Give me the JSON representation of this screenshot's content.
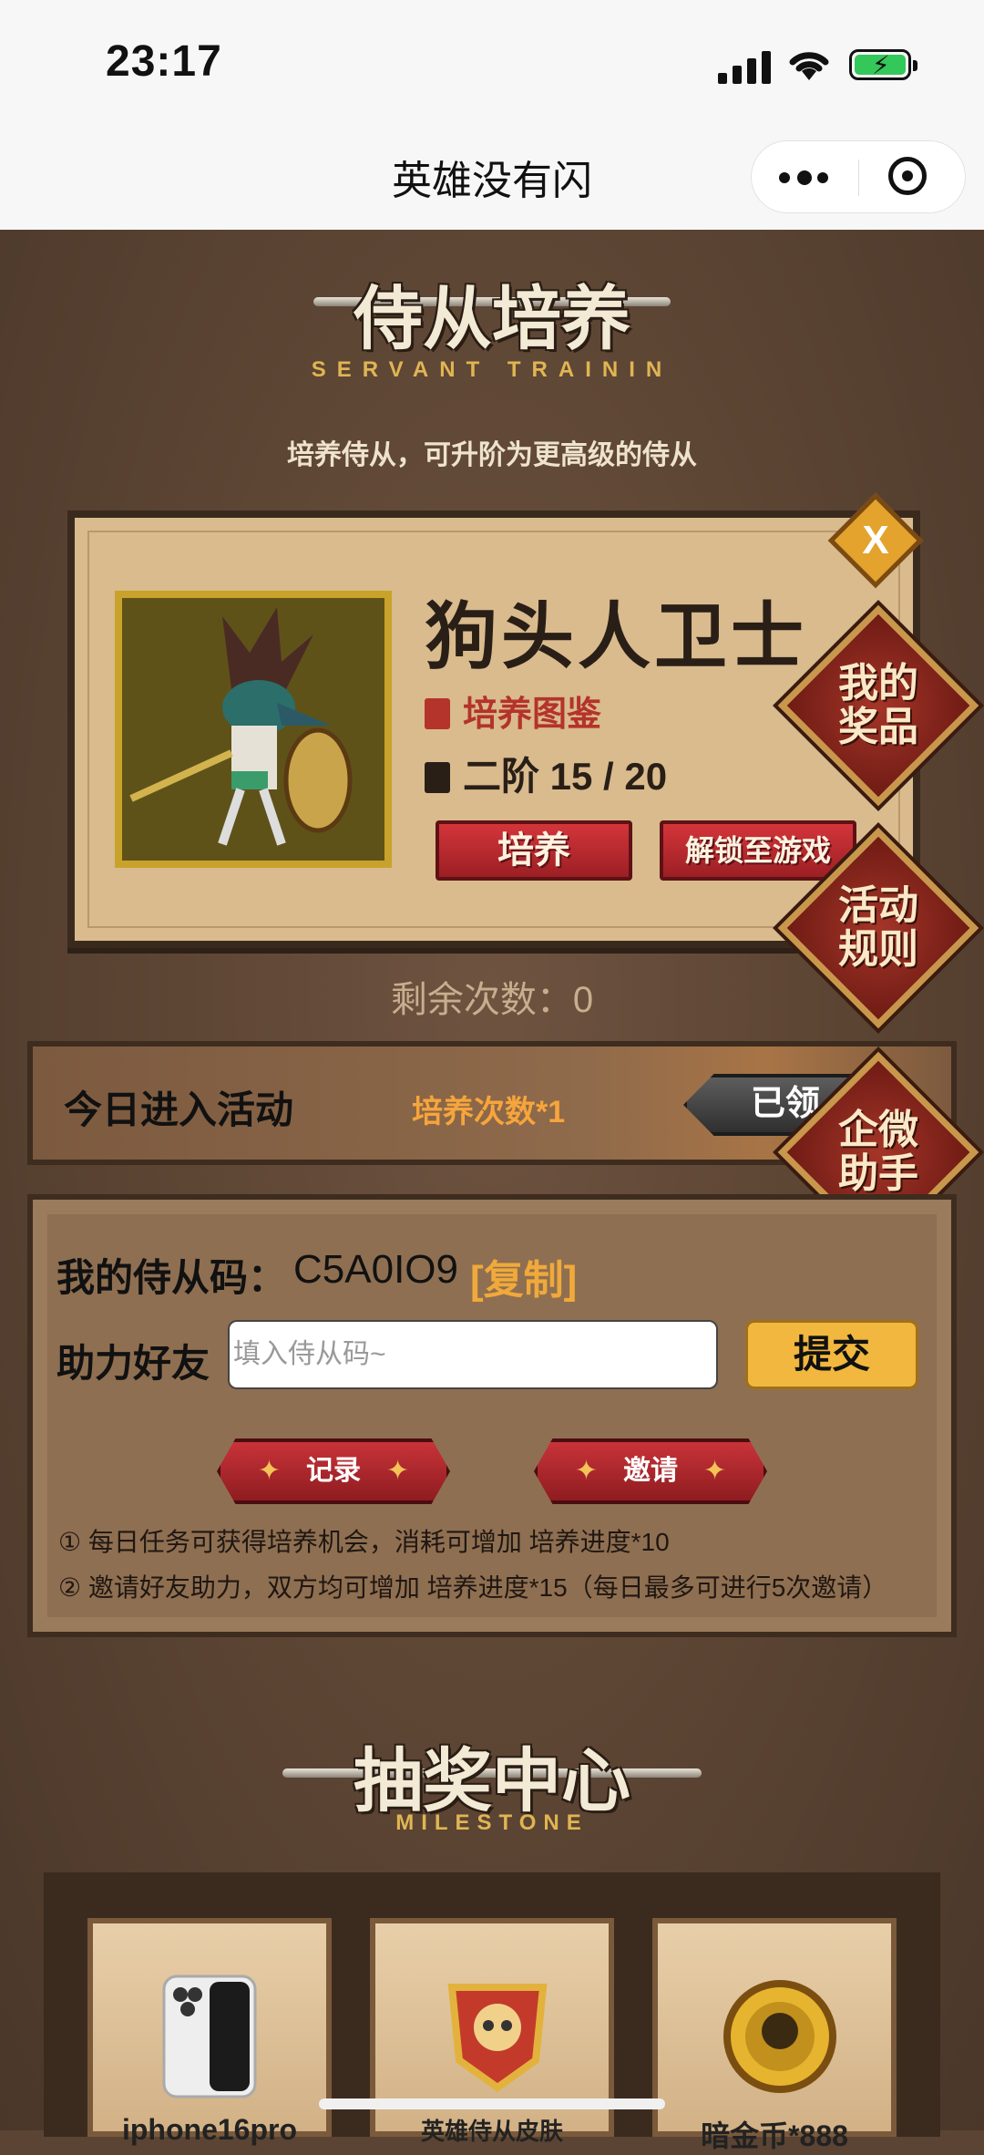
{
  "status_bar": {
    "time": "23:17"
  },
  "nav": {
    "title": "英雄没有闪"
  },
  "banner": {
    "title": "侍从培养",
    "subtitle": "SERVANT TRAININ",
    "tagline": "培养侍从，可升阶为更高级的侍从"
  },
  "servant": {
    "name": "狗头人卫士",
    "atlas_label": "培养图鉴",
    "level_label": "二阶 15 / 20",
    "train_button": "培养",
    "unlock_button": "解锁至游戏",
    "close_icon": "X"
  },
  "side_buttons": [
    {
      "label_line1": "我的",
      "label_line2": "奖品"
    },
    {
      "label_line1": "活动",
      "label_line2": "规则"
    },
    {
      "label_line1": "企微",
      "label_line2": "助手"
    }
  ],
  "remaining": "剩余次数：0",
  "today": {
    "label": "今日进入活动",
    "reward": "培养次数*1",
    "button": "已领"
  },
  "code_panel": {
    "my_code_label": "我的侍从码：",
    "my_code_value": "C5A0IO9",
    "copy_link": "[复制]",
    "help_label": "助力好友",
    "input_placeholder": "填入侍从码~",
    "input_value": "",
    "submit_button": "提交",
    "record_button": "记录",
    "invite_button": "邀请",
    "star_glyph": "✦",
    "rules": [
      "① 每日任务可获得培养机会，消耗可增加 培养进度*10",
      "② 邀请好友助力，双方均可增加 培养进度*15（每日最多可进行5次邀请）"
    ]
  },
  "lottery": {
    "title": "抽奖中心",
    "subtitle": "MILESTONE",
    "prizes": [
      {
        "label": "iphone16pro",
        "icon": "phone-icon"
      },
      {
        "label": "英雄侍从皮肤",
        "icon": "skull-shield-icon"
      },
      {
        "label": "暗金币*888",
        "icon": "skull-coin-icon"
      }
    ]
  },
  "colors": {
    "accent_red": "#b4332b",
    "accent_gold": "#f0a93a",
    "background": "#5b4434",
    "card": "#d9bb8e"
  }
}
